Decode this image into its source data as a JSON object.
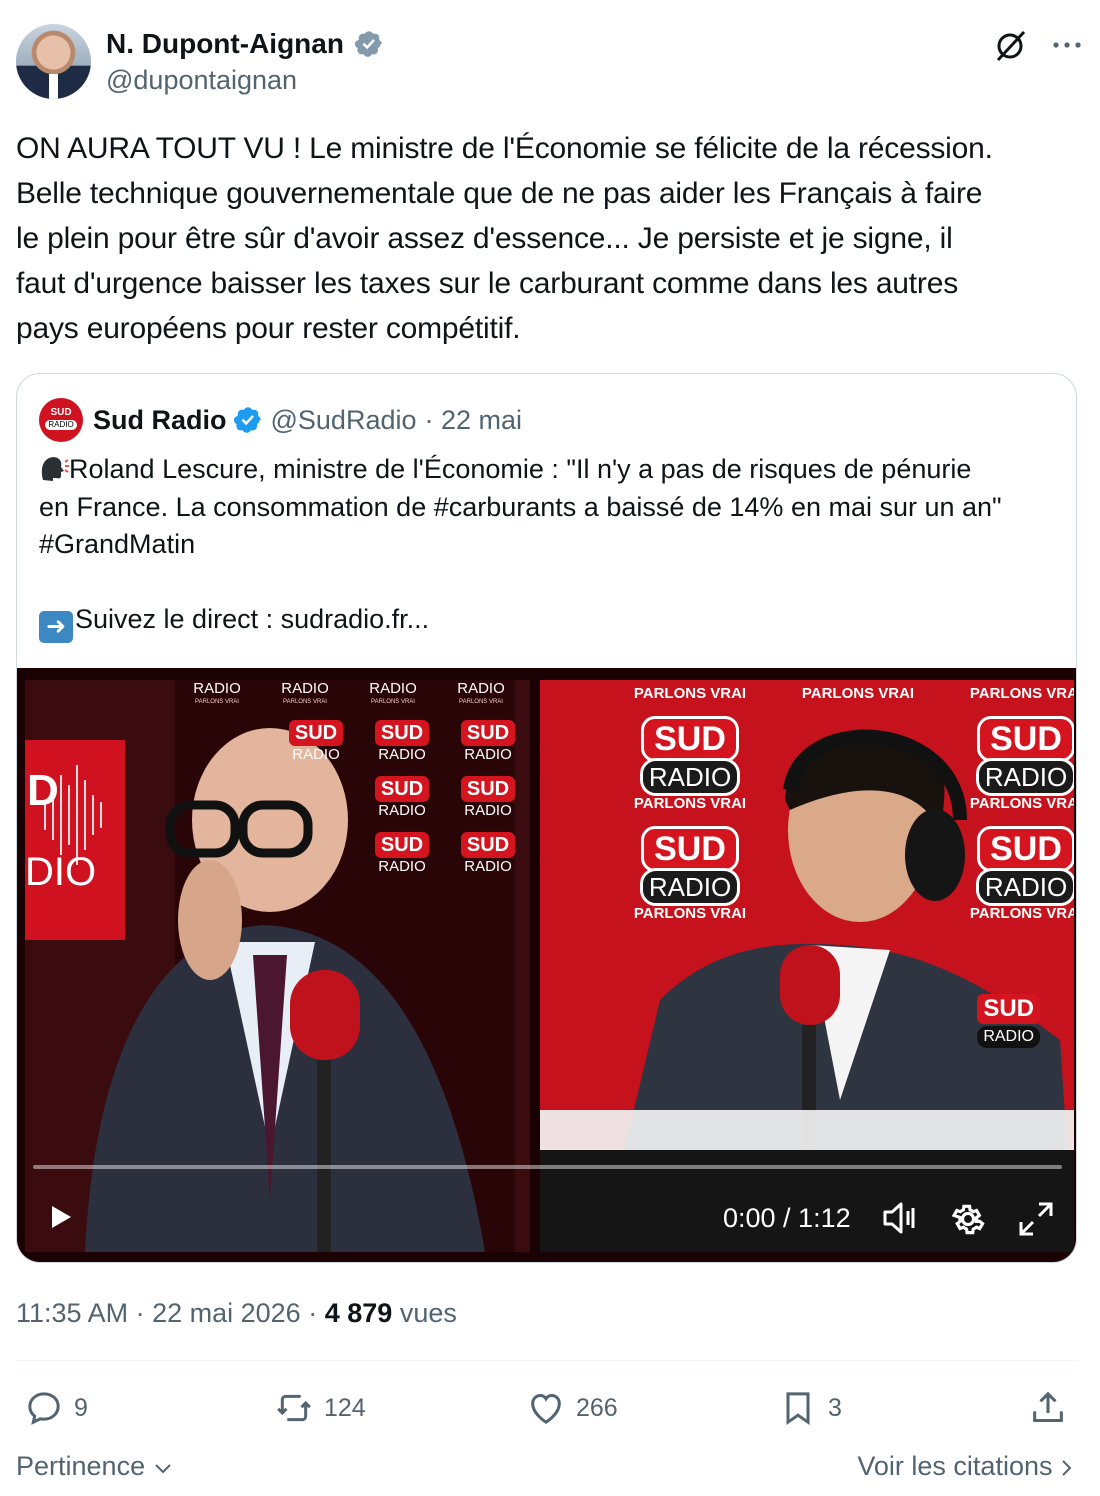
{
  "author": {
    "display_name": "N. Dupont-Aignan",
    "handle": "@dupontaignan"
  },
  "tweet": {
    "text": "ON AURA TOUT VU ! Le ministre de l'Économie se félicite de la récession.\nBelle technique gouvernementale que de ne pas aider les Français à faire\nle plein pour être sûr d'avoir assez d'essence... Je persiste et je signe, il\nfaut d'urgence baisser les taxes sur le carburant comme dans les autres\npays européens pour rester compétitif."
  },
  "quoted": {
    "avatar_line1": "SUD",
    "avatar_line2": "RADIO",
    "display_name": "Sud Radio",
    "handle": "@SudRadio",
    "date": "· 22 mai",
    "text_line1": "Roland Lescure, ministre de l'Économie : \"Il n'y a pas de risques de pénurie\nen France. La consommation de #carburants a baissé de 14% en mai sur un an\"\n#GrandMatin",
    "text_line2": "Suivez le direct : sudradio.fr..."
  },
  "video": {
    "time": "0:00 / 1:12",
    "progress": 0,
    "watermark_sud": "SUD",
    "watermark_radio": "RADIO",
    "wall_sud": "SUD",
    "wall_radio": "RADIO",
    "wall_pv": "PARLONS VRAI",
    "left_logo_top": "D",
    "left_logo_bottom": "DIO"
  },
  "meta": {
    "time": "11:35 AM",
    "date": "22 mai 2026",
    "views_count": "4 879",
    "views_label": "vues"
  },
  "actions": {
    "replies": "9",
    "reposts": "124",
    "likes": "266",
    "bookmarks": "3"
  },
  "footer": {
    "sort_label": "Pertinence",
    "quotes_label": "Voir les citations"
  },
  "colors": {
    "text": "#0f1419",
    "secondary": "#536471",
    "verified": "#829aab",
    "verified_blue": "#1d9bf0",
    "brand_red": "#d4141e"
  }
}
